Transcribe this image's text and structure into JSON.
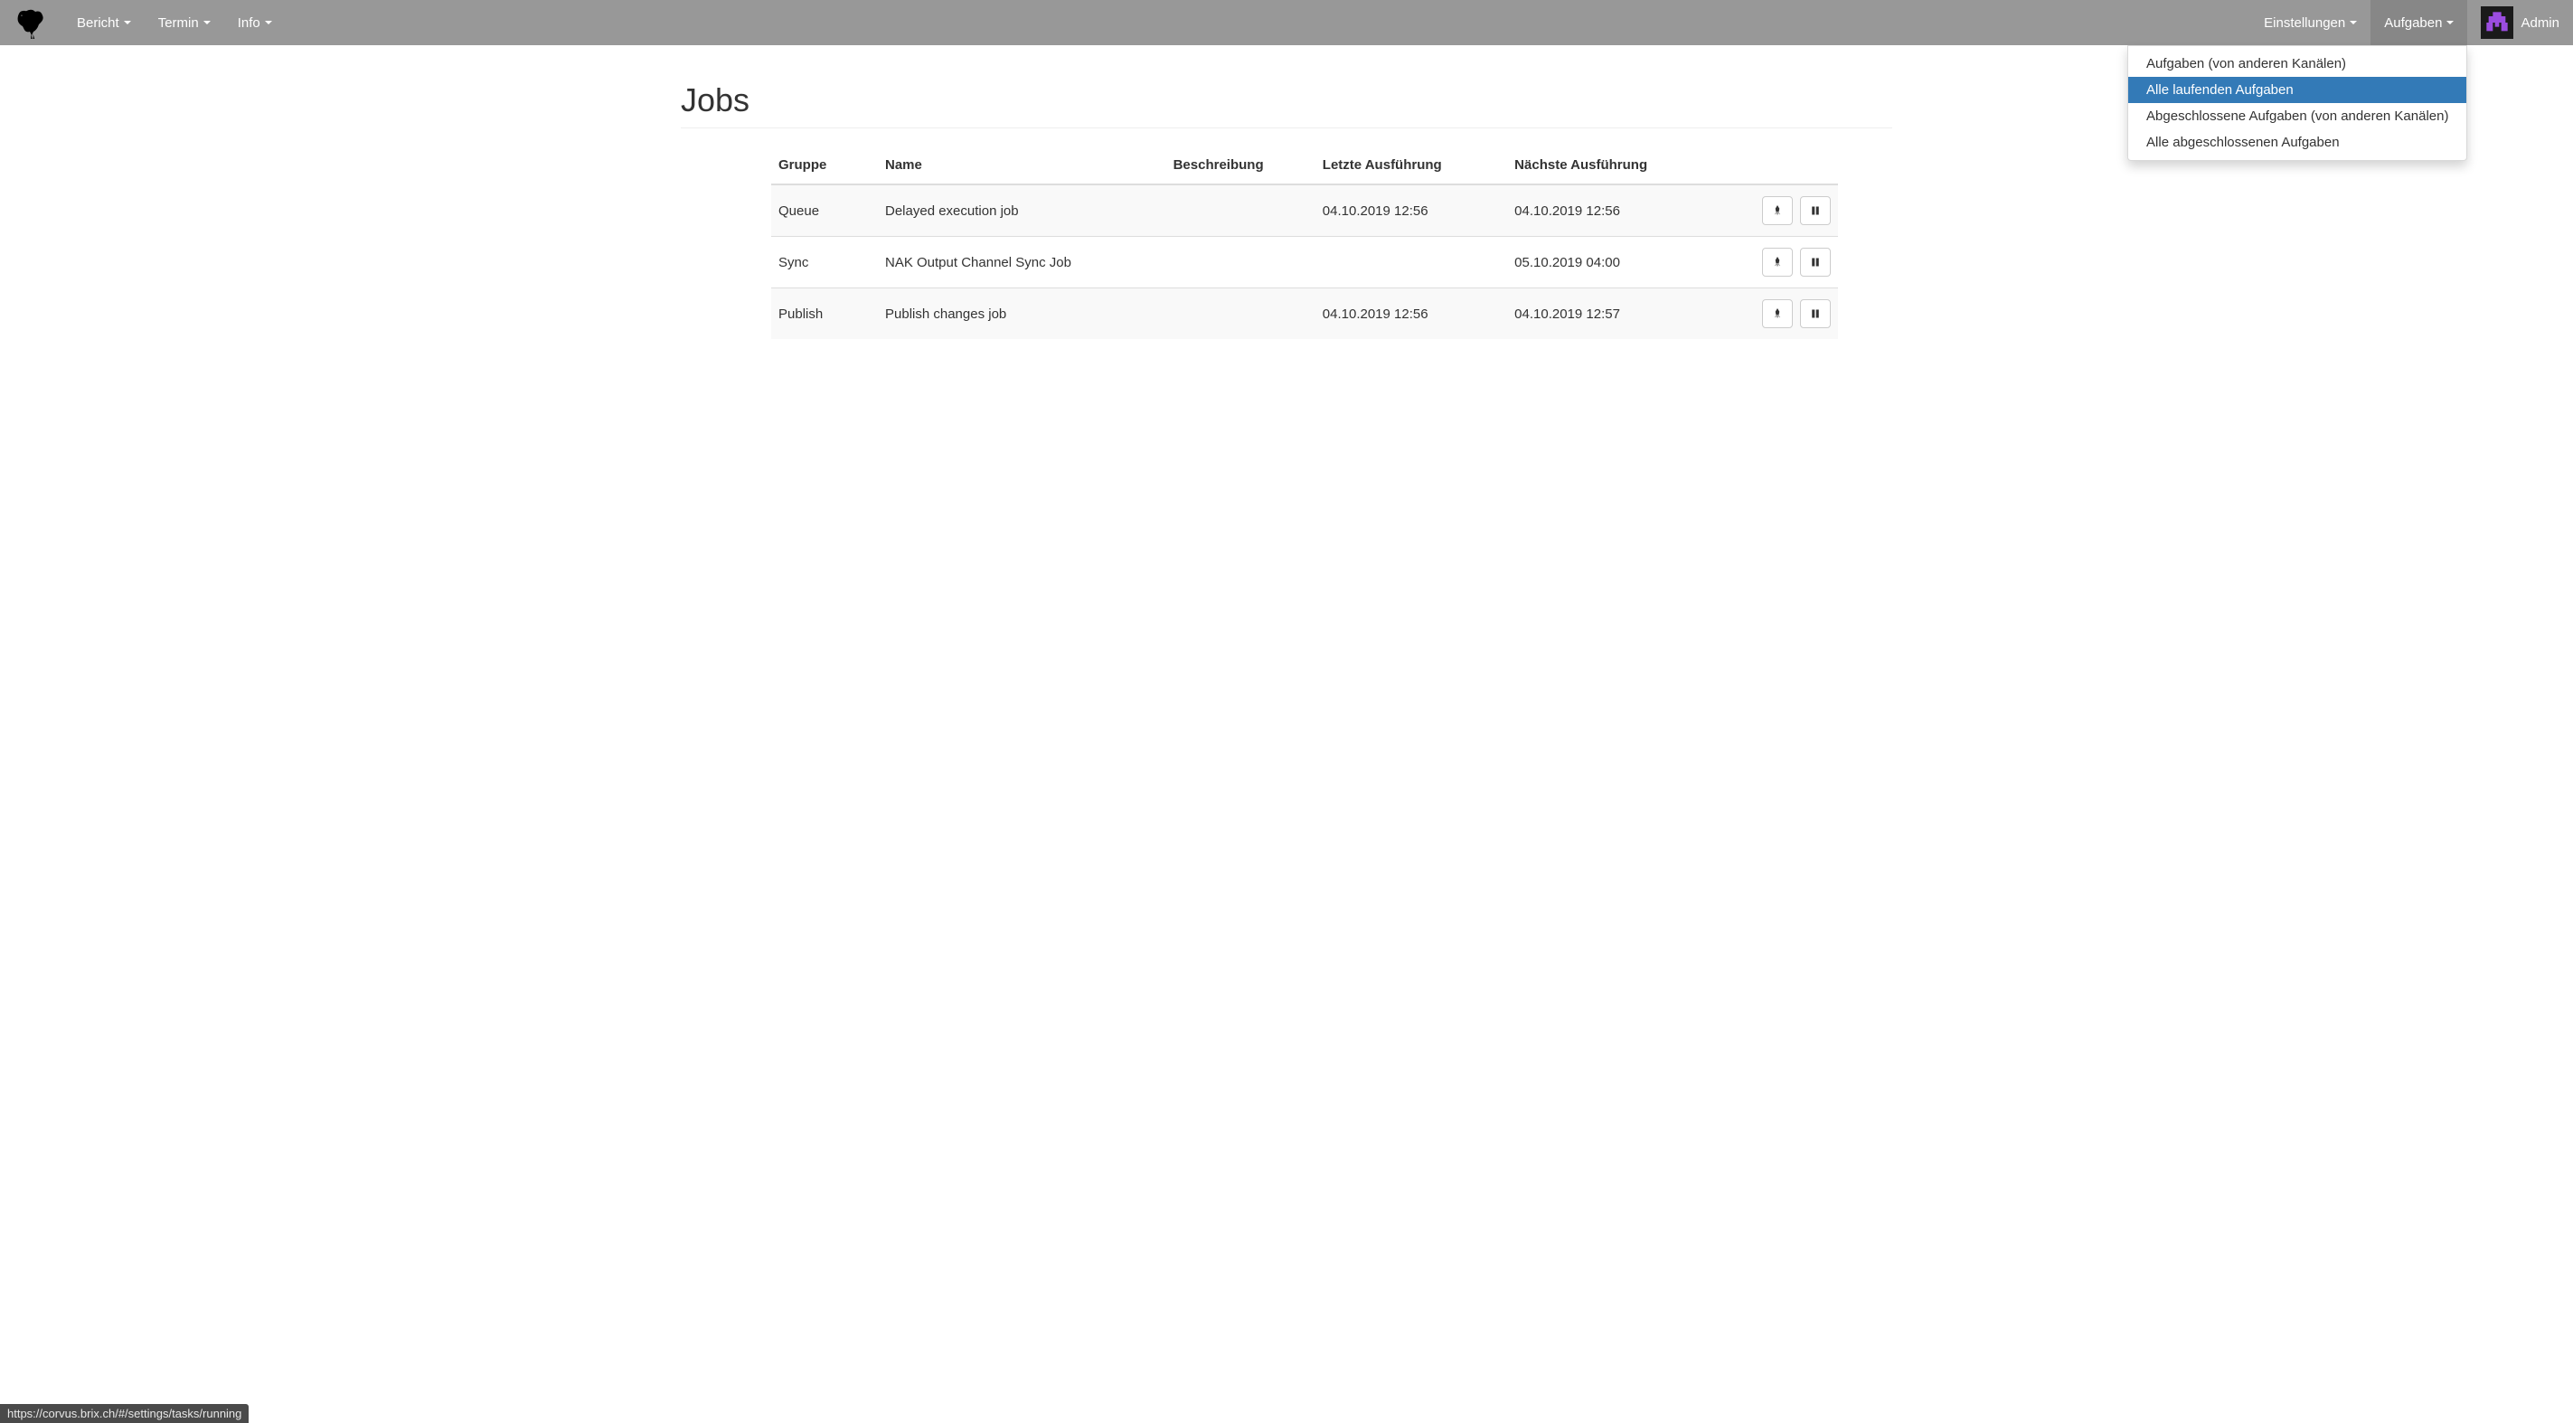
{
  "nav": {
    "left": [
      {
        "label": "Bericht"
      },
      {
        "label": "Termin"
      },
      {
        "label": "Info"
      }
    ],
    "right": [
      {
        "label": "Einstellungen",
        "active": false
      },
      {
        "label": "Aufgaben",
        "active": true
      }
    ],
    "user": "Admin"
  },
  "dropdown": {
    "items": [
      {
        "label": "Aufgaben (von anderen Kanälen)",
        "highlighted": false
      },
      {
        "label": "Alle laufenden Aufgaben",
        "highlighted": true
      },
      {
        "label": "Abgeschlossene Aufgaben (von anderen Kanälen)",
        "highlighted": false
      },
      {
        "label": "Alle abgeschlossenen Aufgaben",
        "highlighted": false
      }
    ]
  },
  "page": {
    "title": "Jobs"
  },
  "table": {
    "headers": {
      "group": "Gruppe",
      "name": "Name",
      "description": "Beschreibung",
      "last_run": "Letzte Ausführung",
      "next_run": "Nächste Ausführung"
    },
    "rows": [
      {
        "group": "Queue",
        "name": "Delayed execution job",
        "description": "",
        "last_run": "04.10.2019 12:56",
        "next_run": "04.10.2019 12:56"
      },
      {
        "group": "Sync",
        "name": "NAK Output Channel Sync Job",
        "description": "",
        "last_run": "",
        "next_run": "05.10.2019 04:00"
      },
      {
        "group": "Publish",
        "name": "Publish changes job",
        "description": "",
        "last_run": "04.10.2019 12:56",
        "next_run": "04.10.2019 12:57"
      }
    ]
  },
  "status_bar": {
    "url": "https://corvus.brix.ch/#/settings/tasks/running"
  }
}
